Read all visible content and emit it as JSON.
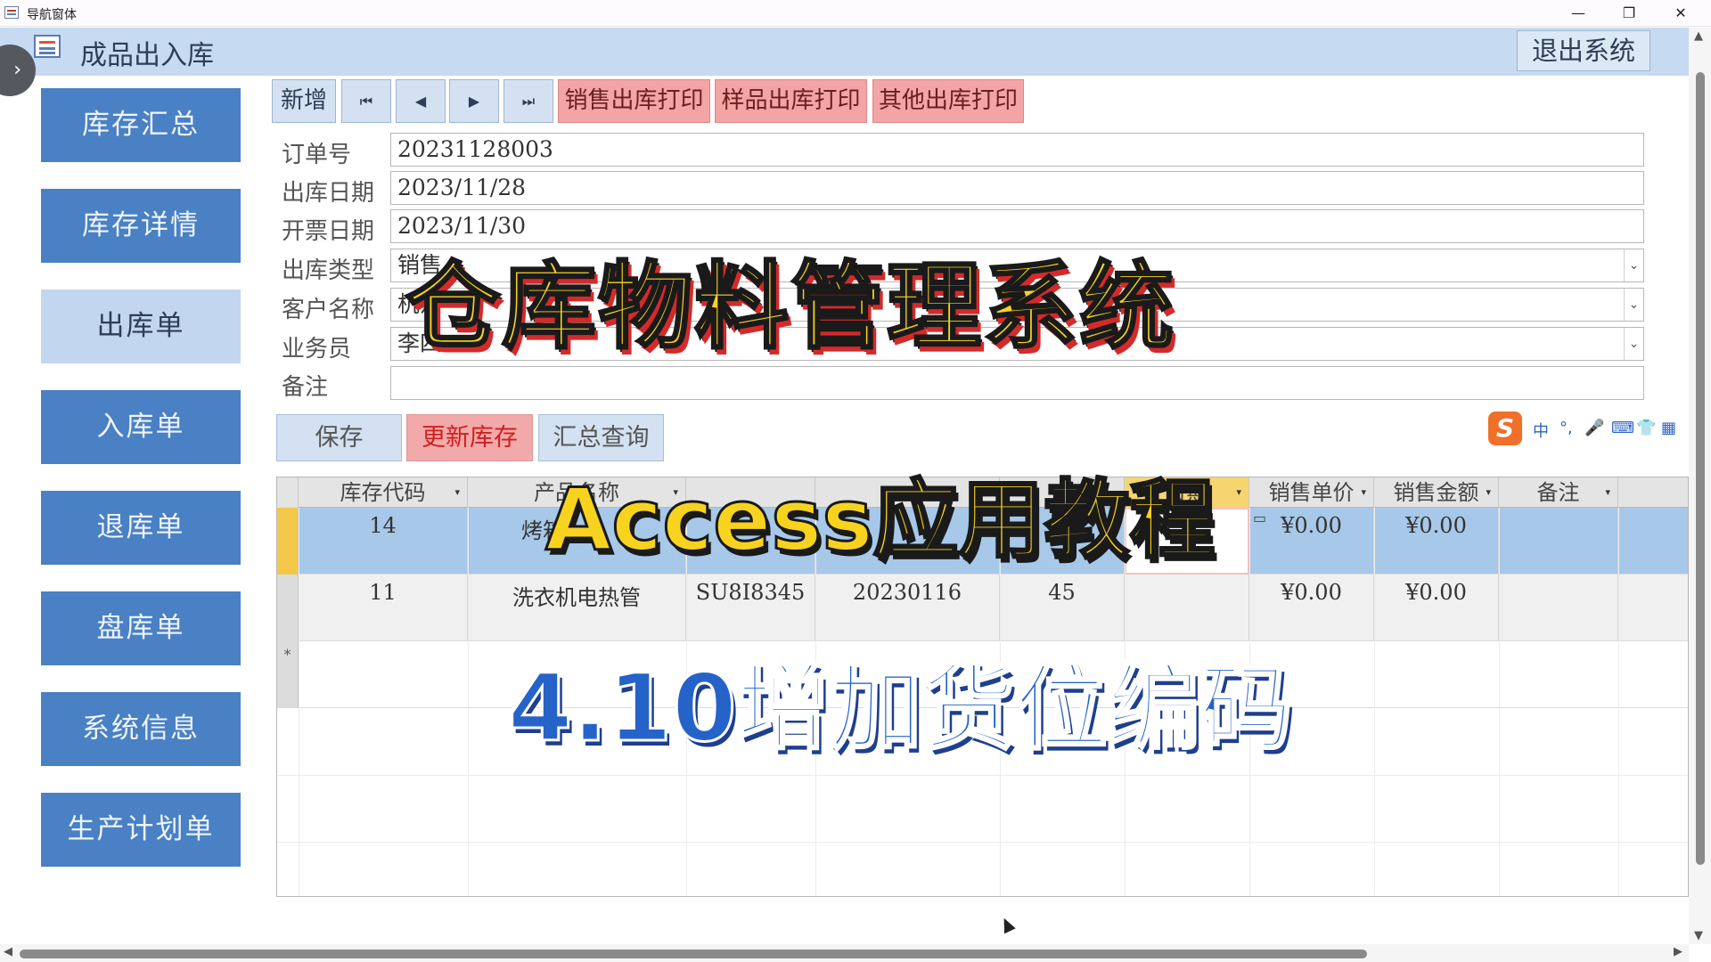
{
  "window": {
    "title": "导航窗体",
    "minimize": "—",
    "restore": "❐",
    "close": "✕"
  },
  "header": {
    "title": "成品出入库",
    "exit_label": "退出系统"
  },
  "nav": {
    "toggle": "›",
    "items": [
      "库存汇总",
      "库存详情",
      "出库单",
      "入库单",
      "退库单",
      "盘库单",
      "系统信息",
      "生产计划单"
    ],
    "active_index": 2
  },
  "toolbar": {
    "new_label": "新增",
    "first_icon": "⏮",
    "prev_icon": "◀",
    "next_icon": "▶",
    "last_icon": "⏭",
    "print_sales": "销售出库打印",
    "print_sample": "样品出库打印",
    "print_other": "其他出库打印"
  },
  "form": {
    "order_no_label": "订单号",
    "order_no": "20231128003",
    "out_date_label": "出库日期",
    "out_date": "2023/11/28",
    "invoice_date_label": "开票日期",
    "invoice_date": "2023/11/30",
    "out_type_label": "出库类型",
    "out_type": "销售",
    "customer_label": "客户名称",
    "customer": "杭州",
    "salesman_label": "业务员",
    "salesman": "李四",
    "remark_label": "备注",
    "remark": ""
  },
  "actions": {
    "save": "保存",
    "update_stock": "更新库存",
    "summary_query": "汇总查询"
  },
  "ime": {
    "logo": "S",
    "items": [
      "中",
      "°,",
      "🎤",
      "⌨",
      "👕",
      "▦"
    ]
  },
  "grid": {
    "headers": [
      "库存代码",
      "产品名称",
      "",
      "",
      "",
      "日期",
      "销售单价",
      "销售金额",
      "备注"
    ],
    "rows": [
      {
        "stock_code": "14",
        "product": "烤箱",
        "model": "",
        "batch": "",
        "qty": "",
        "date": "",
        "unit_price": "¥0.00",
        "amount": "¥0.00",
        "remark": ""
      },
      {
        "stock_code": "11",
        "product": "洗衣机电热管",
        "model": "SU8I8345",
        "batch": "20230116",
        "qty": "45",
        "date": "",
        "unit_price": "¥0.00",
        "amount": "¥0.00",
        "remark": ""
      }
    ],
    "new_row_marker": "*"
  },
  "captions": {
    "line1": "仓库物料管理系统",
    "line2": "Access应用教程",
    "line3": "4.10增加货位编码"
  }
}
